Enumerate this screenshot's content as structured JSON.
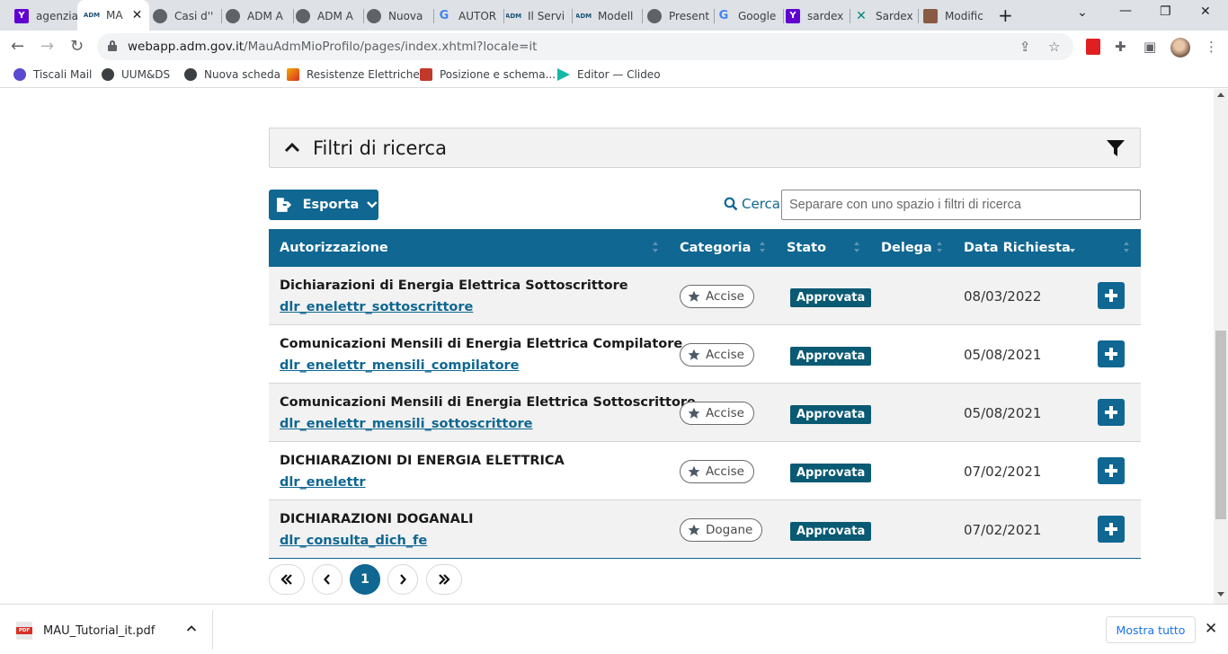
{
  "browser": {
    "tabs": [
      {
        "label": "agenzia",
        "icon": "yahoo"
      },
      {
        "label": "MA",
        "icon": "adm",
        "active": true
      },
      {
        "label": "Casi d''",
        "icon": "globe"
      },
      {
        "label": "ADM A",
        "icon": "globe"
      },
      {
        "label": "ADM A",
        "icon": "globe"
      },
      {
        "label": "Nuova",
        "icon": "globe"
      },
      {
        "label": "AUTOR",
        "icon": "google"
      },
      {
        "label": "Il Servi",
        "icon": "adm"
      },
      {
        "label": "Modell",
        "icon": "adm"
      },
      {
        "label": "Present",
        "icon": "globe"
      },
      {
        "label": "Google",
        "icon": "google"
      },
      {
        "label": "sardex",
        "icon": "yahoo"
      },
      {
        "label": "Sardex",
        "icon": "sardex"
      },
      {
        "label": "Modific",
        "icon": "photo"
      }
    ],
    "url_host": "webapp.adm.gov.it",
    "url_path": "/MauAdmMioProfilo/pages/index.xhtml?locale=it",
    "bookmarks": [
      {
        "label": "Tiscali Mail"
      },
      {
        "label": "UUM&DS"
      },
      {
        "label": "Nuova scheda"
      },
      {
        "label": "Resistenze Elettriche"
      },
      {
        "label": "Posizione e schema..."
      },
      {
        "label": "Editor — Clideo"
      }
    ]
  },
  "filters": {
    "title": "Filtri di ricerca"
  },
  "toolbar": {
    "export_label": "Esporta",
    "search_label": "Cerca",
    "search_placeholder": "Separare con uno spazio i filtri di ricerca",
    "search_value": ""
  },
  "table": {
    "columns": [
      "Autorizzazione",
      "Categoria",
      "Stato",
      "Delega",
      "Data Richiesta"
    ],
    "rows": [
      {
        "title": "Dichiarazioni di Energia Elettrica Sottoscrittore",
        "code": "dlr_enelettr_sottoscrittore",
        "category": "Accise",
        "status": "Approvata",
        "delega": "",
        "date": "08/03/2022"
      },
      {
        "title": "Comunicazioni Mensili di Energia Elettrica Compilatore",
        "code": "dlr_enelettr_mensili_compilatore",
        "category": "Accise",
        "status": "Approvata",
        "delega": "",
        "date": "05/08/2021"
      },
      {
        "title": "Comunicazioni Mensili di Energia Elettrica Sottoscrittore",
        "code": "dlr_enelettr_mensili_sottoscrittore",
        "category": "Accise",
        "status": "Approvata",
        "delega": "",
        "date": "05/08/2021"
      },
      {
        "title": "DICHIARAZIONI DI ENERGIA ELETTRICA",
        "code": "dlr_enelettr",
        "category": "Accise",
        "status": "Approvata",
        "delega": "",
        "date": "07/02/2021"
      },
      {
        "title": "DICHIARAZIONI DOGANALI",
        "code": "dlr_consulta_dich_fe",
        "category": "Dogane",
        "status": "Approvata",
        "delega": "",
        "date": "07/02/2021"
      }
    ]
  },
  "pagination": {
    "current_page": "1"
  },
  "downloads": {
    "file_name": "MAU_Tutorial_it.pdf",
    "file_badge": "PDF",
    "show_all_label": "Mostra tutto"
  },
  "colors": {
    "primary": "#0f6792",
    "status_badge": "#0a5a73",
    "row_alt": "#f2f2f2"
  }
}
